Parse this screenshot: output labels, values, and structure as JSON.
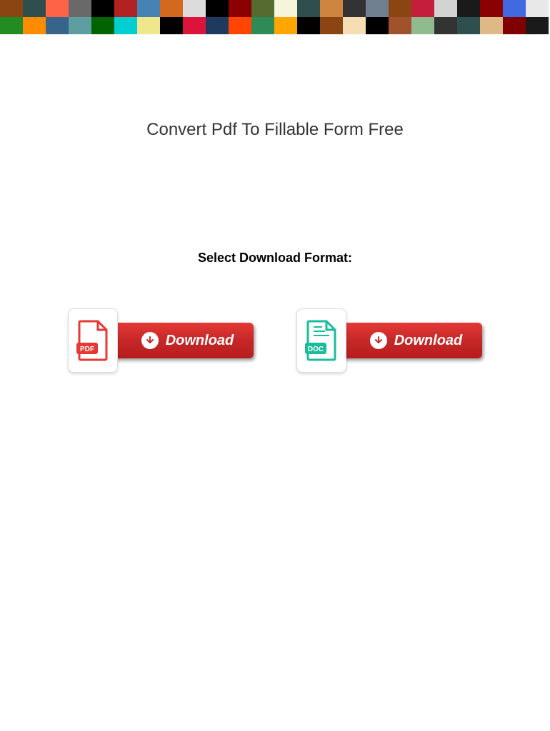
{
  "page": {
    "title": "Convert Pdf To Fillable Form Free",
    "select_label": "Select Download Format:"
  },
  "downloads": {
    "pdf": {
      "icon_label": "PDF",
      "button_label": "Download"
    },
    "doc": {
      "icon_label": "DOC",
      "button_label": "Download"
    }
  },
  "banner_colors": [
    "#8b4513",
    "#2f4f4f",
    "#ff6347",
    "#696969",
    "#000000",
    "#b22222",
    "#4682b4",
    "#d2691e",
    "#dcdcdc",
    "#000000",
    "#8b0000",
    "#556b2f",
    "#f5f5dc",
    "#2f4f4f",
    "#cd853f",
    "#333333",
    "#708090",
    "#8b4513",
    "#c41e3a",
    "#d3d3d3",
    "#1a1a1a",
    "#8b0000",
    "#4169e1",
    "#e8e8e8",
    "#228b22",
    "#ff8c00",
    "#36648b",
    "#5f9ea0",
    "#006400",
    "#00ced1",
    "#f0e68c",
    "#000000",
    "#dc143c",
    "#1e3a5f",
    "#ff4500",
    "#2e8b57",
    "#ffa500",
    "#000000",
    "#8b4513",
    "#f5deb3",
    "#000000",
    "#a0522d",
    "#8fbc8f",
    "#333333",
    "#2f4f4f",
    "#deb887",
    "#800000",
    "#1a1a1a"
  ]
}
